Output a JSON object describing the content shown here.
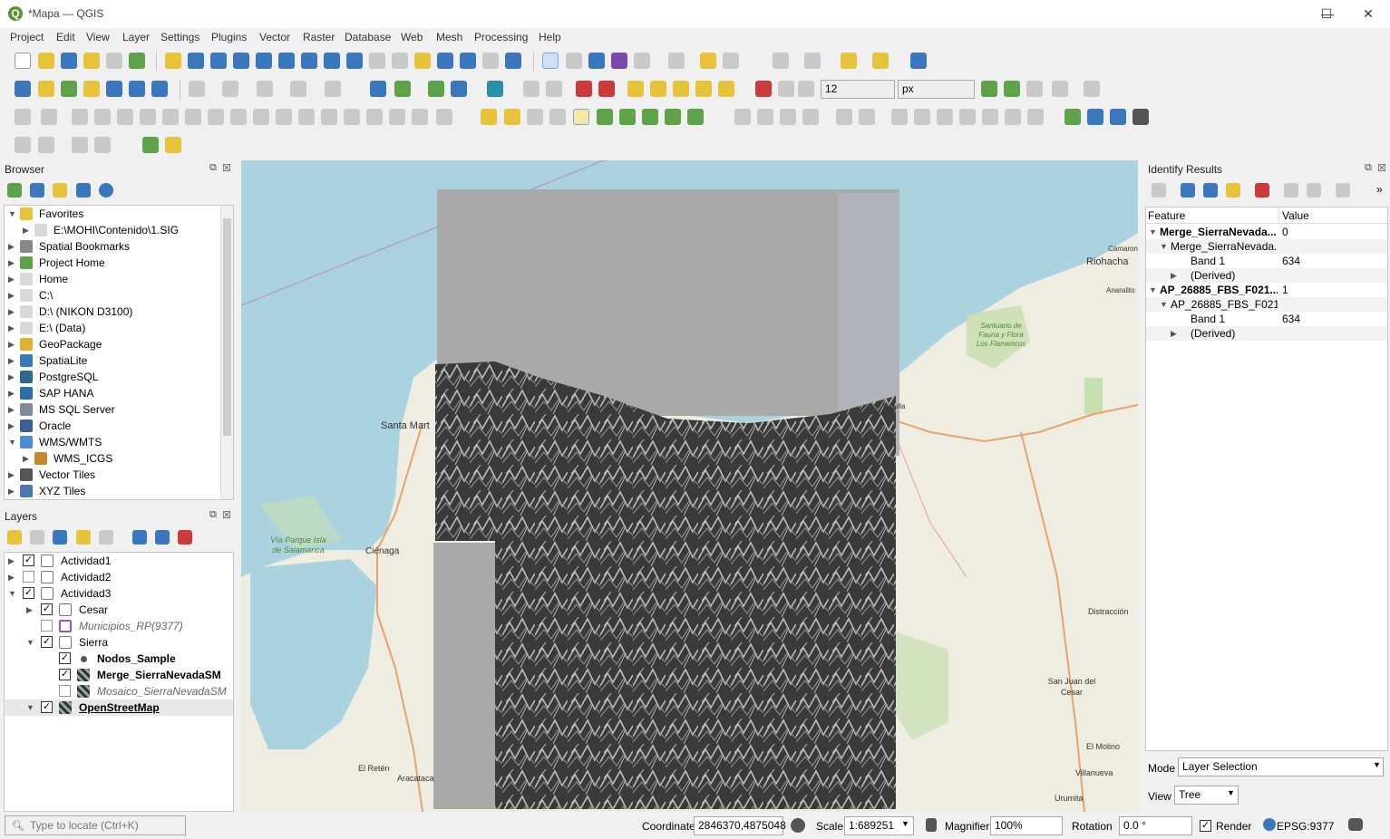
{
  "window": {
    "title": "*Mapa — QGIS",
    "app_logo": "Q",
    "controls": {
      "minimize": "—",
      "maximize": "☐",
      "close": "✕"
    }
  },
  "menu": [
    "Project",
    "Edit",
    "View",
    "Layer",
    "Settings",
    "Plugins",
    "Vector",
    "Raster",
    "Database",
    "Web",
    "Mesh",
    "Processing",
    "Help"
  ],
  "toolbar": {
    "font_size_value": "12",
    "unit_value": "px"
  },
  "browser": {
    "title": "Browser",
    "items": [
      {
        "label": "Favorites",
        "expanded": true,
        "icon": "star-icon"
      },
      {
        "label": "E:\\MOHI\\Contenido\\1.SIG",
        "indent": 1,
        "icon": "folder-icon"
      },
      {
        "label": "Spatial Bookmarks",
        "icon": "bookmark-icon"
      },
      {
        "label": "Project Home",
        "icon": "project-home-icon"
      },
      {
        "label": "Home",
        "icon": "folder-icon"
      },
      {
        "label": "C:\\",
        "icon": "drive-icon"
      },
      {
        "label": "D:\\ (NIKON D3100)",
        "icon": "drive-icon"
      },
      {
        "label": "E:\\ (Data)",
        "icon": "drive-icon"
      },
      {
        "label": "GeoPackage",
        "icon": "geopackage-icon"
      },
      {
        "label": "SpatiaLite",
        "icon": "spatialite-icon"
      },
      {
        "label": "PostgreSQL",
        "icon": "postgresql-icon"
      },
      {
        "label": "SAP HANA",
        "icon": "sap-hana-icon"
      },
      {
        "label": "MS SQL Server",
        "icon": "mssql-icon"
      },
      {
        "label": "Oracle",
        "icon": "oracle-icon"
      },
      {
        "label": "WMS/WMTS",
        "expanded": true,
        "icon": "globe-icon"
      },
      {
        "label": "WMS_ICGS",
        "indent": 1,
        "icon": "wms-icon"
      },
      {
        "label": "Vector Tiles",
        "icon": "vector-tiles-icon"
      },
      {
        "label": "XYZ Tiles",
        "icon": "xyz-tiles-icon"
      }
    ]
  },
  "layers": {
    "title": "Layers",
    "items": [
      {
        "label": "Actividad1",
        "checked": true,
        "type": "group"
      },
      {
        "label": "Actividad2",
        "checked": false,
        "type": "group"
      },
      {
        "label": "Actividad3",
        "checked": true,
        "type": "group"
      },
      {
        "label": "Cesar",
        "checked": true,
        "type": "group"
      },
      {
        "label": "Municipios_RP(9377)",
        "checked": false,
        "type": "polygon"
      },
      {
        "label": "Sierra",
        "checked": true,
        "type": "group"
      },
      {
        "label": "Nodos_Sample",
        "checked": true,
        "type": "point"
      },
      {
        "label": "Merge_SierraNevadaSM",
        "checked": true,
        "type": "raster"
      },
      {
        "label": "Mosaico_SierraNevadaSM",
        "checked": false,
        "type": "raster"
      },
      {
        "label": "OpenStreetMap",
        "checked": true,
        "type": "raster"
      }
    ]
  },
  "locator": {
    "placeholder": "Type to locate (Ctrl+K)"
  },
  "identify": {
    "title": "Identify Results",
    "col_feature": "Feature",
    "col_value": "Value",
    "rows": [
      {
        "feature": "Merge_SierraNevada...",
        "value": "0"
      },
      {
        "feature": "Merge_SierraNevada...",
        "value": ""
      },
      {
        "feature": "Band 1",
        "value": "634"
      },
      {
        "feature": "(Derived)",
        "value": ""
      },
      {
        "feature": "AP_26885_FBS_F021...",
        "value": "1"
      },
      {
        "feature": "AP_26885_FBS_F021...",
        "value": ""
      },
      {
        "feature": "Band 1",
        "value": "634"
      },
      {
        "feature": "(Derived)",
        "value": ""
      }
    ],
    "mode_label": "Mode",
    "mode_value": "Layer Selection",
    "view_label": "View",
    "view_value": "Tree"
  },
  "map_labels": {
    "riohacha": "Riohacha",
    "santa_marta": "Santa Mart",
    "cienaga": "Ciénaga",
    "via_parque": "Vía Parque Isla de Salamanca",
    "distraccion": "Distracción",
    "san_juan": "San Juan del Cesar",
    "el_molino": "El Molino",
    "urumita": "Urumita",
    "villanueva": "Villanueva",
    "el_reten": "El Retén",
    "aracataca": "Aracataca",
    "santuario": "Santuario de Fauna y Flora Los Flamencos",
    "anaralito": "Anaralito",
    "camarones": "Camarones",
    "dibulla": "Dibulla"
  },
  "status": {
    "coordinate_label": "Coordinate",
    "coordinate_value": "2846370,4875048",
    "scale_label": "Scale",
    "scale_value": "1:689251",
    "magnifier_label": "Magnifier",
    "magnifier_value": "100%",
    "rotation_label": "Rotation",
    "rotation_value": "0.0 °",
    "render_label": "Render",
    "render_checked": true,
    "crs_label": "EPSG:9377"
  }
}
